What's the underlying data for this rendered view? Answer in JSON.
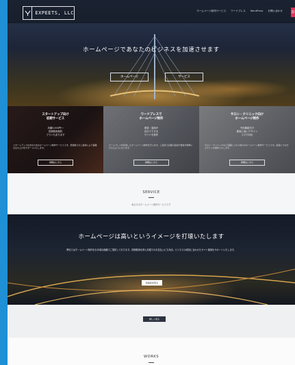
{
  "header": {
    "logo_text": "EXPEETS, LLC",
    "nav": [
      "ホームページ制作サービス",
      "ワードプレス",
      "WordPress",
      "お問い合わせ"
    ],
    "contact_label": "お"
  },
  "hero": {
    "title": "ホームページであなたのビジネスを加速させます",
    "buttons": [
      "ホームページ",
      "サービス"
    ]
  },
  "features": [
    {
      "title": "スタートアップ向け\n初期サービス",
      "lines": "月額5,000円〜\n初期費用無料\nプランもあります",
      "desc": "スタートアップの方のためのホームページ制作サービスです。低価格でのご提供により事業の立ち上げをサポートいたします。",
      "button": "詳細はこちら"
    },
    {
      "title": "ワードプレスで\nホームページ制作",
      "lines": "更新・運用が\n自分でできる\nサイトを制作",
      "desc": "ワードプレスを利用したホームページ制作を行います。ご自身で記事の追加や更新が簡単に行えるようになります。",
      "button": "詳細はこちら"
    },
    {
      "title": "サロン・クリニック向け\nホームページ制作",
      "lines": "予約機能付き\n集客に強いデザイン\nスマホ対応",
      "desc": "サロン・クリニックなど店舗ビジネス向けのホームページ制作サービスです。集客につながるサイトを制作いたします。",
      "button": "詳細はこちら"
    }
  ],
  "service": {
    "title": "SERVICE",
    "subtitle": "私たちのホームページ制作サービスです"
  },
  "band": {
    "title": "ホームページは高いというイメージを打壊いたします",
    "text": "弊社ではホームページ制作をお手頃な価格でご提供しております。初期費用を抑え月額でのお支払いにも対応。ビジネスの成長に合わせたサイト運用をサポートいたします。",
    "button": "料金表を見る"
  },
  "strip": {
    "button": "詳しく見る"
  },
  "works": {
    "title": "WORKS"
  }
}
